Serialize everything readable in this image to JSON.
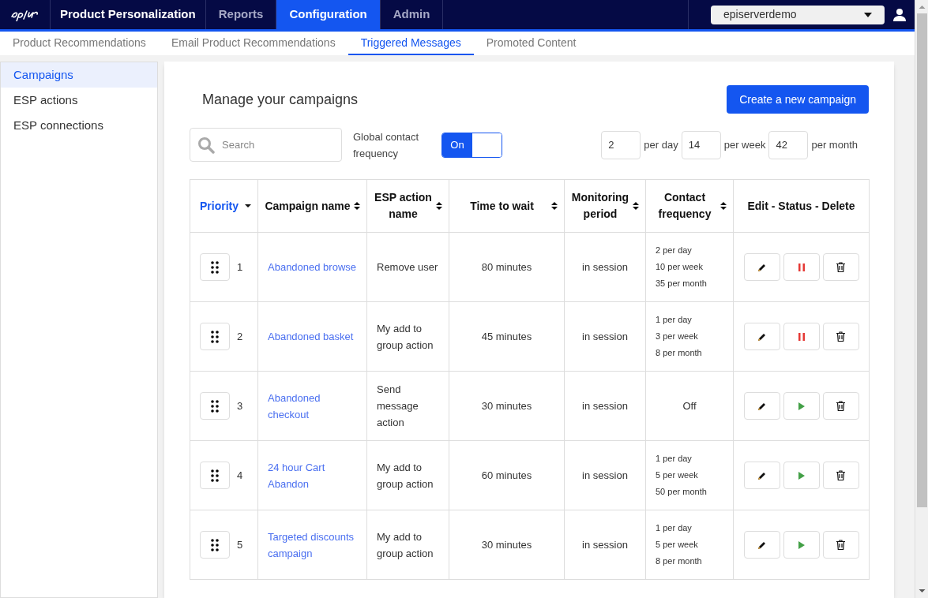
{
  "topnav": {
    "product": "Product Personalization",
    "items": [
      {
        "label": "Reports",
        "selected": false
      },
      {
        "label": "Configuration",
        "selected": true
      },
      {
        "label": "Admin",
        "selected": false
      }
    ],
    "site": "episerverdemo"
  },
  "subtabs": [
    {
      "label": "Product Recommendations",
      "selected": false
    },
    {
      "label": "Email Product Recommendations",
      "selected": false
    },
    {
      "label": "Triggered Messages",
      "selected": true
    },
    {
      "label": "Promoted Content",
      "selected": false
    }
  ],
  "sidebar": {
    "items": [
      {
        "label": "Campaigns",
        "selected": true
      },
      {
        "label": "ESP actions",
        "selected": false
      },
      {
        "label": "ESP connections",
        "selected": false
      }
    ]
  },
  "title": "Manage your campaigns",
  "create_button": "Create a new campaign",
  "search": {
    "placeholder": "Search"
  },
  "global_frequency": {
    "label": "Global contact frequency",
    "toggle": "On",
    "on": true,
    "limits": [
      {
        "value": "2",
        "unit": "per day"
      },
      {
        "value": "14",
        "unit": "per week"
      },
      {
        "value": "42",
        "unit": "per month"
      }
    ]
  },
  "table": {
    "columns": [
      {
        "label": "Priority",
        "sorted": true
      },
      {
        "label": "Campaign name",
        "sorted": false
      },
      {
        "label": "ESP action name",
        "sorted": false
      },
      {
        "label": "Time to wait",
        "sorted": false
      },
      {
        "label": "Monitoring period",
        "sorted": false
      },
      {
        "label": "Contact frequency",
        "sorted": false
      },
      {
        "label": "Edit - Status - Delete"
      }
    ],
    "rows": [
      {
        "priority": "1",
        "name": "Abandoned browse",
        "esp_action": "Remove user",
        "wait": "80 minutes",
        "period": "in session",
        "frequency": [
          "2 per day",
          "10 per week",
          "35 per month"
        ],
        "active": true
      },
      {
        "priority": "2",
        "name": "Abandoned basket",
        "esp_action": "My add to group action",
        "wait": "45 minutes",
        "period": "in session",
        "frequency": [
          "1 per day",
          "3 per week",
          "8 per month"
        ],
        "active": true
      },
      {
        "priority": "3",
        "name": "Abandoned checkout",
        "esp_action": "Send message action",
        "wait": "30 minutes",
        "period": "in session",
        "frequency": [
          "Off"
        ],
        "active": false
      },
      {
        "priority": "4",
        "name": "24 hour Cart Abandon",
        "esp_action": "My add to group action",
        "wait": "60 minutes",
        "period": "in session",
        "frequency": [
          "1 per day",
          "5 per week",
          "50 per month"
        ],
        "active": false
      },
      {
        "priority": "5",
        "name": "Targeted discounts campaign",
        "esp_action": "My add to group action",
        "wait": "30 minutes",
        "period": "in session",
        "frequency": [
          "1 per day",
          "5 per week",
          "8 per month"
        ],
        "active": false
      }
    ]
  }
}
